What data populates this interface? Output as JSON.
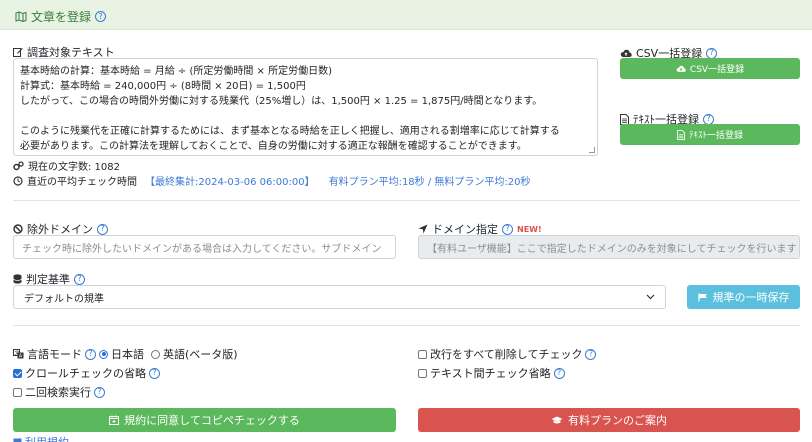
{
  "header": {
    "title": "文章を登録"
  },
  "target": {
    "label": "調査対象テキスト",
    "lines": [
      "基本時給の計算：基本時給 = 月給 ÷ (所定労働時間 × 所定労働日数)",
      "計算式：基本時給 = 240,000円 ÷ (8時間 × 20日) = 1,500円",
      "したがって、この場合の時間外労働に対する残業代（25%増し）は、1,500円 × 1.25 = 1,875円/時間となります。",
      "",
      "このように残業代を正確に計算するためには、まず基本となる時給を正しく把握し、適用される割増率に応じて計算する",
      "必要があります。この計算法を理解しておくことで、自身の労働に対する適正な報酬を確認することができます。"
    ],
    "char_count": "現在の文字数: 1082",
    "avg_label": "直近の平均チェック時間",
    "avg_stat": "【最終集計:2024-03-06 06:00:00】",
    "avg_times": "有料プラン平均:18秒 / 無料プラン平均:20秒"
  },
  "csv": {
    "label": "CSV一括登録",
    "button": "CSV一括登録"
  },
  "text_bulk": {
    "label": "ﾃｷｽﾄ一括登録",
    "button": "ﾃｷｽﾄ一括登録"
  },
  "exclude_domain": {
    "label": "除外ドメイン",
    "placeholder": "チェック時に除外したいドメインがある場合は入力してください。サブドメイン"
  },
  "domain_spec": {
    "label": "ドメイン指定",
    "new_badge": "NEW!",
    "placeholder": "【有料ユーザ機能】ここで指定したドメインのみを対象にしてチェックを行います"
  },
  "criteria": {
    "label": "判定基準",
    "selected": "デフォルトの規準",
    "save_button": "規準の一時保存"
  },
  "options": {
    "language_mode": "言語モード",
    "lang_ja": "日本語",
    "lang_en": "英語(ベータ版)",
    "remove_newlines": "改行をすべて削除してチェック",
    "crawl_skip": "クロールチェックの省略",
    "text_skip": "テキスト間チェック省略",
    "double_search": "二回検索実行"
  },
  "actions": {
    "agree_check": "規約に同意してコピペチェックする",
    "paid_plan": "有料プランのご案内",
    "terms": "利用規約"
  },
  "colors": {
    "green": "#5cb85c",
    "red": "#d9534f",
    "info": "#5bc0de",
    "link": "#3d7ad6"
  }
}
